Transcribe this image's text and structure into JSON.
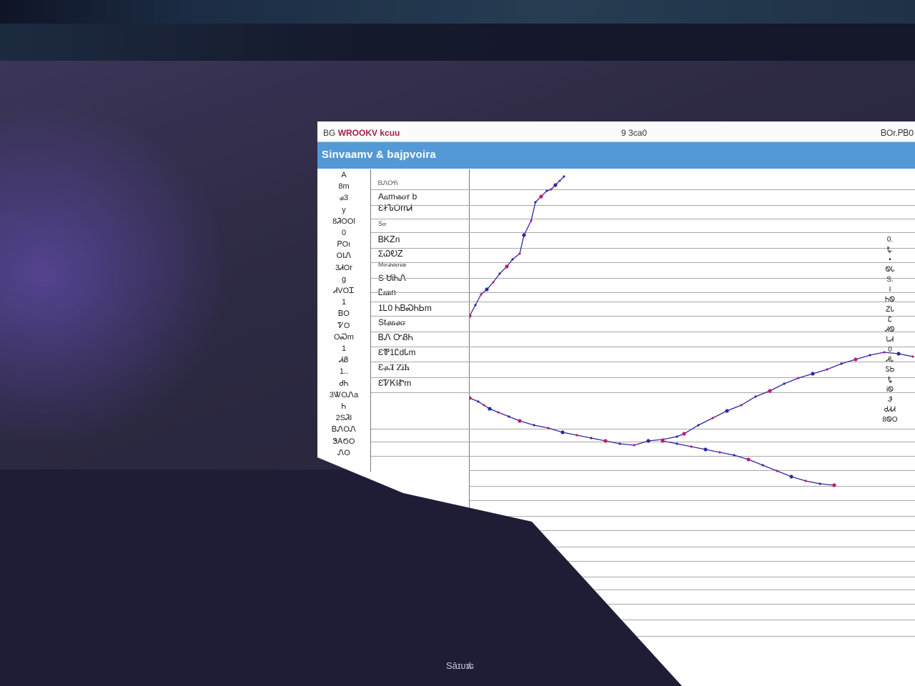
{
  "window": {
    "title_prefix": "ΒG",
    "title_accent": "WROOKV kcuu",
    "center_info": "9 3ca0",
    "right_info": "ᏴOr.ᏢᏴ0",
    "panel_title": "Sinvaamv & bajpvoira"
  },
  "axis_ticks": [
    "A",
    "8m",
    "ᏸ3",
    "y",
    "8ᏘOOl",
    "0",
    "ᏢOı",
    "OIᏁ",
    "3ᏗOr",
    "g",
    "ᏗVOᏆ",
    "1",
    "ᏴO",
    "ᏤO",
    "OᏍm",
    "1",
    "ᏗᏰ",
    "1..",
    "ᏧᏂ",
    "3ᏔOᏁa",
    "Ꮒ",
    "2SᏘI",
    "ᏴᏁOᏁ",
    "ᏕᎪϬO",
    "ᏁO"
  ],
  "row_labels": [
    {
      "text": "ᏴᏁᎤᏲ",
      "small": true
    },
    {
      "text": "Aᏺmᏹᏻr b",
      "small": false
    },
    {
      "text": "ƐᏐᏖOrnᏗ",
      "small": false
    },
    {
      "text": "Sᏻ",
      "small": true
    },
    {
      "text": "ᏴᏦᏃn",
      "small": false
    },
    {
      "text": "ΣᏇᎧᏃ",
      "small": false
    },
    {
      "text": "Μᏻᏸᏹᏻᏺᏼ",
      "small": true
    },
    {
      "text": "S ᏌᎥᏂᏁ",
      "small": false
    },
    {
      "text": "Ꮭᏺᏼn",
      "small": false
    },
    {
      "text": "1Ꮮ0 ᏂᏴᏍᏂᏏm",
      "small": false
    },
    {
      "text": "Stᏸᏺᏸᏻ",
      "small": false
    },
    {
      "text": "ᏴᏁ ᏅᏰᏂ",
      "small": false
    },
    {
      "text": "ƐᏈ1ᏝdᏓm",
      "small": false
    },
    {
      "text": "ƐᏸᏘ ᏃᎥᏂ",
      "small": false
    },
    {
      "text": "ƐᏤᏦIᏑm",
      "small": false
    }
  ],
  "right_ticks": [
    "0.",
    "Ꮏ.",
    "•",
    "ᏫᏓ",
    "S.",
    "I",
    "ᏂᏫ",
    "ᏃᏓ",
    "Ꮭ",
    "ᏗᏫ",
    "ᏓᏗ",
    "0",
    "ᏗᏓ",
    "ᏚᏏ",
    "Ꮏ",
    "ᎥᏫ",
    "Ꮽ",
    "ᏧᏗᏗ",
    "8ᏫO"
  ],
  "status_text": "Sāɪᴜɪ̸ɕ",
  "colors": {
    "series_primary": "#2c2aa0",
    "series_accent": "#c4186f",
    "header": "#5399d6"
  },
  "chart_data": {
    "type": "line",
    "series": [
      {
        "x": [
          0,
          8,
          16,
          24,
          33,
          42,
          52,
          60,
          70,
          76,
          86,
          92,
          100,
          108,
          114,
          120,
          126,
          132
        ],
        "y": [
          205,
          190,
          175,
          168,
          158,
          146,
          136,
          126,
          118,
          92,
          72,
          46,
          38,
          30,
          28,
          22,
          16,
          10
        ]
      },
      {
        "x": [
          0,
          12,
          20,
          28,
          40,
          55,
          70,
          90,
          110,
          130,
          150,
          170,
          190,
          210,
          230,
          250,
          270,
          290,
          300,
          320,
          340,
          360,
          380,
          400,
          420,
          440,
          460,
          480,
          500,
          520,
          540,
          560,
          580,
          600,
          620
        ],
        "y": [
          320,
          325,
          330,
          335,
          340,
          346,
          352,
          358,
          362,
          368,
          372,
          376,
          380,
          384,
          386,
          380,
          378,
          374,
          370,
          358,
          348,
          338,
          330,
          318,
          310,
          300,
          292,
          286,
          280,
          272,
          266,
          260,
          256,
          258,
          262
        ]
      },
      {
        "x": [
          270,
          290,
          310,
          330,
          350,
          370,
          390,
          410,
          430,
          450,
          470,
          490,
          510
        ],
        "y": [
          380,
          384,
          388,
          392,
          396,
          400,
          406,
          414,
          422,
          430,
          436,
          440,
          442
        ]
      }
    ]
  }
}
